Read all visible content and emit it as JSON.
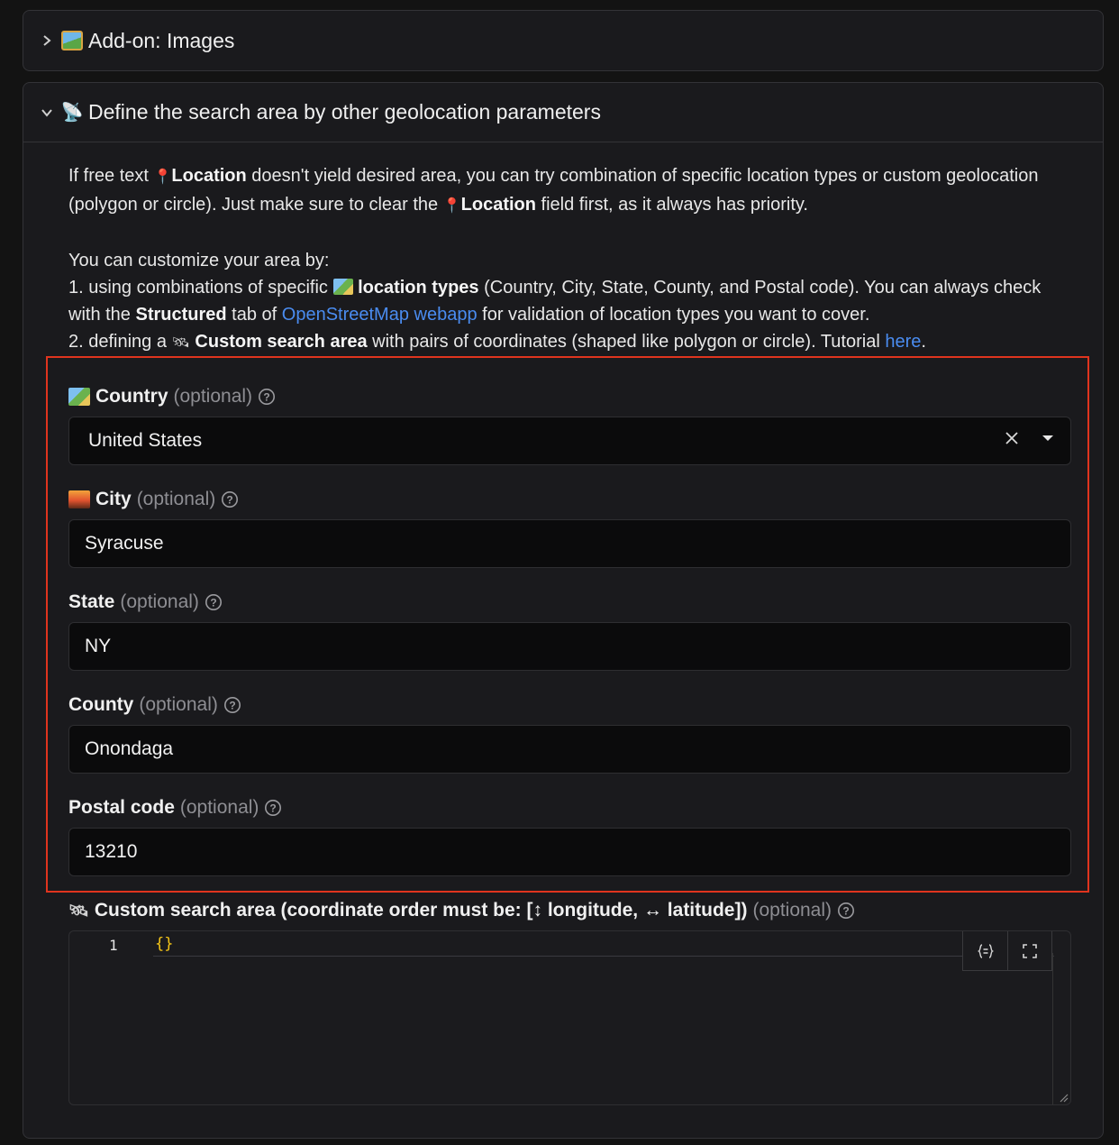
{
  "sections": {
    "images": {
      "title": "Add-on: Images",
      "expanded": false,
      "icon": "framed-picture-icon"
    },
    "geo": {
      "title": "Define the search area by other geolocation parameters",
      "expanded": true,
      "icon": "satellite-antenna-icon",
      "desc": {
        "p1_a": "If free text ",
        "p1_loc1": "Location",
        "p1_b": " doesn't yield desired area, you can try combination of specific location types or custom geolocation (polygon or circle). Just make sure to clear the ",
        "p1_loc2": "Location",
        "p1_c": " field first, as it always has priority.",
        "p2_intro": "You can customize your area by:",
        "p2_1a": "1. using combinations of specific ",
        "p2_1b": "location types",
        "p2_1c": " (Country, City, State, County, and Postal code). You can always check with the ",
        "p2_1d": "Structured",
        "p2_1e": " tab of ",
        "p2_1link": "OpenStreetMap webapp",
        "p2_1f": " for validation of location types you want to cover.",
        "p2_2a": "2. defining a ",
        "p2_2b": "Custom search area",
        "p2_2c": " with pairs of coordinates (shaped like polygon or circle). Tutorial ",
        "p2_2link": "here",
        "p2_2d": "."
      }
    }
  },
  "fields": {
    "country": {
      "label": "Country",
      "optional": "(optional)",
      "value": "United States"
    },
    "city": {
      "label": "City",
      "optional": "(optional)",
      "value": "Syracuse"
    },
    "state": {
      "label": "State",
      "optional": "(optional)",
      "value": "NY"
    },
    "county": {
      "label": "County",
      "optional": "(optional)",
      "value": "Onondaga"
    },
    "postal": {
      "label": "Postal code",
      "optional": "(optional)",
      "value": "13210"
    }
  },
  "custom_area": {
    "label": "Custom search area (coordinate order must be: [",
    "lon": " longitude, ",
    "lat": " latitude])",
    "optional": "(optional)",
    "line_number": "1",
    "code": "{}"
  },
  "colors": {
    "accent_link": "#4a8cf0",
    "highlight_border": "#e0341e",
    "code_brace": "#f5c518"
  }
}
